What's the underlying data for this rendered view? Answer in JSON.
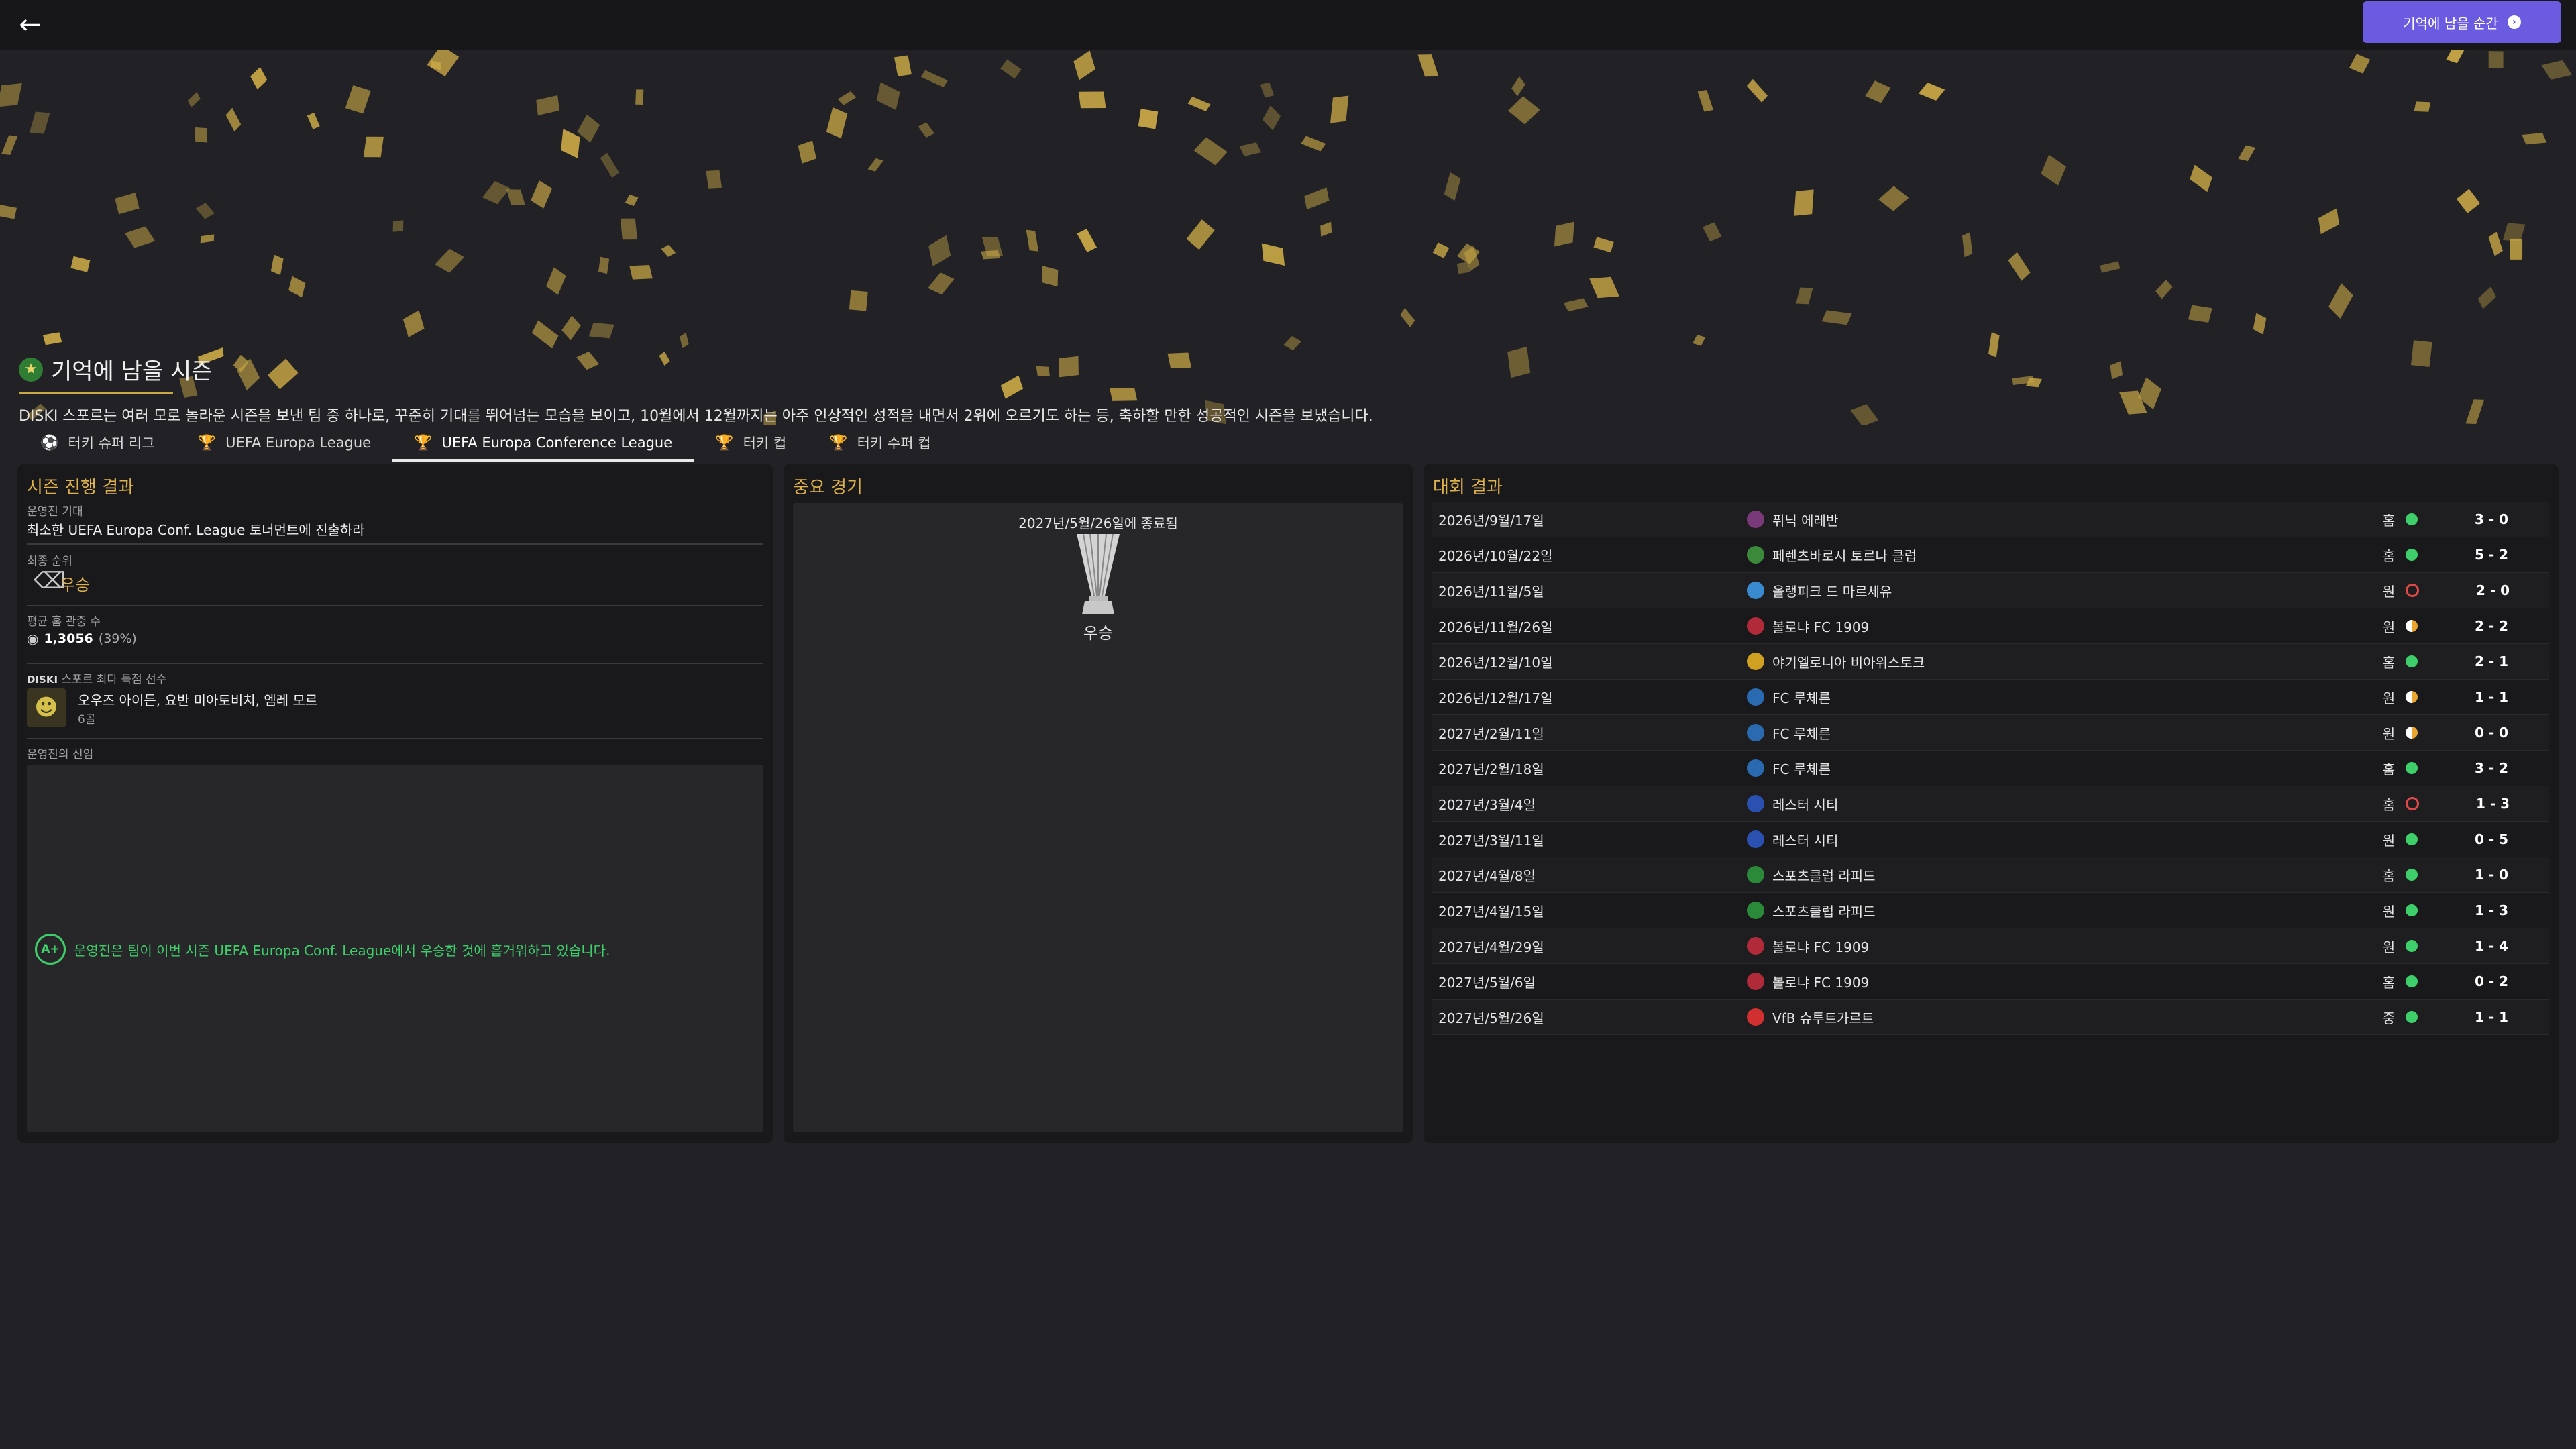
{
  "header": {
    "back_icon": "arrow-left-icon",
    "memorable_button": "기억에 남을 순간"
  },
  "hero": {
    "title": "기억에 남을 시즌",
    "description": "DISKI 스포르는 여러 모로 놀라운 시즌을 보낸 팀 중 하나로, 꾸준히 기대를 뛰어넘는 모습을 보이고, 10월에서 12월까지는 아주 인상적인 성적을 내면서 2위에 오르기도 하는 등, 축하할 만한 성공적인 시즌을 보냈습니다."
  },
  "tabs": [
    {
      "label": "터키 슈퍼 리그",
      "icon": "ball-icon"
    },
    {
      "label": "UEFA Europa League",
      "icon": "trophy-icon"
    },
    {
      "label": "UEFA Europa Conference League",
      "icon": "trophy-icon",
      "active": true
    },
    {
      "label": "터키 컵",
      "icon": "cup-icon"
    },
    {
      "label": "터키 수퍼 컵",
      "icon": "cup-icon"
    }
  ],
  "season_progress": {
    "title": "시즌 진행 결과",
    "expectation_label": "운영진 기대",
    "expectation_value": "최소한 UEFA Europa Conf. League 토너먼트에 진출하라",
    "final_rank_label": "최종 순위",
    "final_rank_value": "우승",
    "attendance_label": "평균 홈 관중 수",
    "attendance_value": "1,3056",
    "attendance_pct": "(39%)",
    "top_scorer_club": "DISKI",
    "top_scorer_label": "스포르 최다 득점 선수",
    "top_scorer_names": "오우즈 아이든, 요반 미아토비치, 엠레 모르",
    "top_scorer_goals": "6골",
    "board_label": "운영진의 신임",
    "board_grade": "A+",
    "board_message": "운영진은 팀이 이번 시즌 UEFA Europa Conf. League에서 우승한 것에 흡거워하고 있습니다."
  },
  "key_match": {
    "title": "중요 경기",
    "date": "2027년/5월/26일에 종료됨",
    "result": "우승"
  },
  "results": {
    "title": "대회 결과",
    "colors": {
      "win": "#3ecf6a",
      "draw": "#e8a530",
      "loss": "#e04848"
    },
    "rows": [
      {
        "date": "2026년/9월/17일",
        "team": "퓌닉 에레반",
        "venue": "홈",
        "outcome": "win",
        "score": "3 - 0",
        "logo": "#7a3a7a"
      },
      {
        "date": "2026년/10월/22일",
        "team": "페렌츠바로시 토르나 클럽",
        "venue": "홈",
        "outcome": "win",
        "score": "5 - 2",
        "logo": "#3b8a3b"
      },
      {
        "date": "2026년/11월/5일",
        "team": "올랭피크 드 마르세유",
        "venue": "원",
        "outcome": "loss",
        "score": "2 - 0",
        "logo": "#3a8ad0"
      },
      {
        "date": "2026년/11월/26일",
        "team": "볼로냐 FC 1909",
        "venue": "원",
        "outcome": "draw",
        "score": "2 - 2",
        "logo": "#b02a3a"
      },
      {
        "date": "2026년/12월/10일",
        "team": "야기엘로니아 비아위스토크",
        "venue": "홈",
        "outcome": "win",
        "score": "2 - 1",
        "logo": "#d0a020"
      },
      {
        "date": "2026년/12월/17일",
        "team": "FC 루체른",
        "venue": "원",
        "outcome": "draw",
        "score": "1 - 1",
        "logo": "#2a6ab0"
      },
      {
        "date": "2027년/2월/11일",
        "team": "FC 루체른",
        "venue": "원",
        "outcome": "draw",
        "score": "0 - 0",
        "logo": "#2a6ab0"
      },
      {
        "date": "2027년/2월/18일",
        "team": "FC 루체른",
        "venue": "홈",
        "outcome": "win",
        "score": "3 - 2",
        "logo": "#2a6ab0"
      },
      {
        "date": "2027년/3월/4일",
        "team": "레스터 시티",
        "venue": "홈",
        "outcome": "loss",
        "score": "1 - 3",
        "logo": "#2a50b0"
      },
      {
        "date": "2027년/3월/11일",
        "team": "레스터 시티",
        "venue": "원",
        "outcome": "win",
        "score": "0 - 5",
        "logo": "#2a50b0"
      },
      {
        "date": "2027년/4월/8일",
        "team": "스포츠클럽 라피드",
        "venue": "홈",
        "outcome": "win",
        "score": "1 - 0",
        "logo": "#2a8a3a"
      },
      {
        "date": "2027년/4월/15일",
        "team": "스포츠클럽 라피드",
        "venue": "원",
        "outcome": "win",
        "score": "1 - 3",
        "logo": "#2a8a3a"
      },
      {
        "date": "2027년/4월/29일",
        "team": "볼로냐 FC 1909",
        "venue": "원",
        "outcome": "win",
        "score": "1 - 4",
        "logo": "#b02a3a"
      },
      {
        "date": "2027년/5월/6일",
        "team": "볼로냐 FC 1909",
        "venue": "홈",
        "outcome": "win",
        "score": "0 - 2",
        "logo": "#b02a3a"
      },
      {
        "date": "2027년/5월/26일",
        "team": "VfB 슈투트가르트",
        "venue": "중",
        "outcome": "win",
        "score": "1 - 1",
        "logo": "#d03030"
      }
    ]
  }
}
